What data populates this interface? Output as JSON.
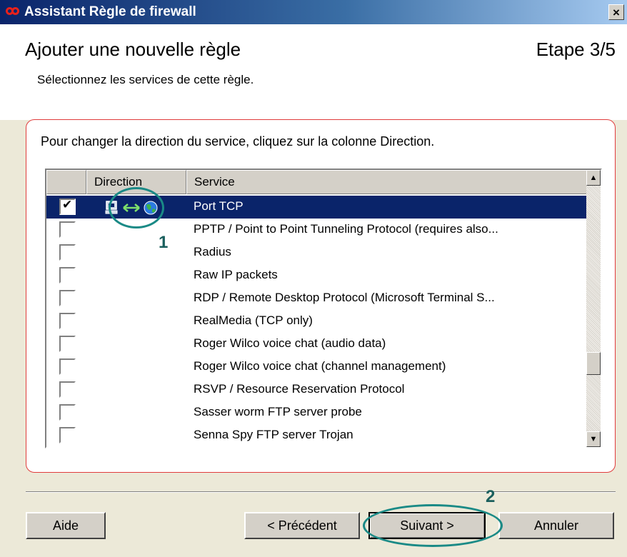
{
  "window": {
    "title": "Assistant Règle de firewall",
    "close_glyph": "×"
  },
  "header": {
    "title": "Ajouter une nouvelle règle",
    "step": "Etape 3/5",
    "subtitle": "Sélectionnez les services de cette règle."
  },
  "content": {
    "instruction": "Pour changer la direction du service, cliquez sur la colonne Direction.",
    "columns": {
      "direction": "Direction",
      "service": "Service"
    },
    "rows": [
      {
        "checked": true,
        "selected": true,
        "has_direction": true,
        "service": "Port TCP"
      },
      {
        "checked": false,
        "selected": false,
        "has_direction": false,
        "service": "PPTP / Point to Point Tunneling Protocol (requires also..."
      },
      {
        "checked": false,
        "selected": false,
        "has_direction": false,
        "service": "Radius"
      },
      {
        "checked": false,
        "selected": false,
        "has_direction": false,
        "service": "Raw IP packets"
      },
      {
        "checked": false,
        "selected": false,
        "has_direction": false,
        "service": "RDP / Remote Desktop Protocol (Microsoft Terminal S..."
      },
      {
        "checked": false,
        "selected": false,
        "has_direction": false,
        "service": "RealMedia (TCP only)"
      },
      {
        "checked": false,
        "selected": false,
        "has_direction": false,
        "service": "Roger Wilco voice chat (audio data)"
      },
      {
        "checked": false,
        "selected": false,
        "has_direction": false,
        "service": "Roger Wilco voice chat (channel management)"
      },
      {
        "checked": false,
        "selected": false,
        "has_direction": false,
        "service": "RSVP / Resource Reservation Protocol"
      },
      {
        "checked": false,
        "selected": false,
        "has_direction": false,
        "service": "Sasser worm FTP server probe"
      },
      {
        "checked": false,
        "selected": false,
        "has_direction": false,
        "service": "Senna Spy FTP server Trojan"
      }
    ],
    "icons": {
      "local": "computer-icon",
      "direction": "bidirectional-arrow-icon",
      "remote": "globe-icon"
    }
  },
  "buttons": {
    "help": "Aide",
    "previous": "< Précédent",
    "next": "Suivant >",
    "cancel": "Annuler"
  },
  "annotations": {
    "first": "1",
    "second": "2"
  },
  "colors": {
    "selection": "#0a246a",
    "border_accent": "#e03c3c",
    "annotation": "#1a8a86"
  }
}
